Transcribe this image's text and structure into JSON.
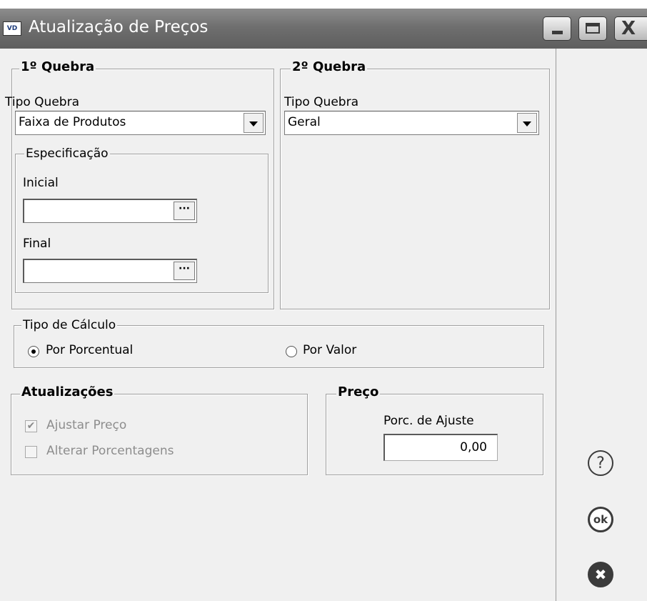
{
  "window": {
    "app_icon": "VD",
    "title": "Atualização de Preços"
  },
  "titlebar_buttons": {
    "close_glyph": "X"
  },
  "quebra1": {
    "legend": "1º Quebra",
    "tipo_label": "Tipo Quebra",
    "tipo_value": "Faixa de Produtos",
    "espec": {
      "legend": "Especificação",
      "inicial_label": "Inicial",
      "inicial_value": "",
      "final_label": "Final",
      "final_value": "",
      "lookup_glyph": "···"
    }
  },
  "quebra2": {
    "legend": "2º Quebra",
    "tipo_label": "Tipo Quebra",
    "tipo_value": "Geral"
  },
  "calculo": {
    "legend": "Tipo de Cálculo",
    "options": [
      "Por Porcentual",
      "Por Valor"
    ],
    "selected": "Por Porcentual"
  },
  "atualizacoes": {
    "legend": "Atualizações",
    "ajustar_preco": {
      "label": "Ajustar Preço",
      "checked": true,
      "check_glyph": "✔"
    },
    "alterar_porcentagens": {
      "label": "Alterar Porcentagens",
      "checked": false
    }
  },
  "preco": {
    "legend": "Preço",
    "porc_label": "Porc. de Ajuste",
    "porc_value": "0,00"
  },
  "side_buttons": {
    "help_glyph": "?",
    "ok_glyph": "ok",
    "cancel_glyph": "✖"
  },
  "icons": [
    "app-icon",
    "minimize-icon",
    "maximize-icon",
    "close-icon",
    "dropdown-arrow-icon",
    "ellipsis-icon",
    "help-icon",
    "ok-icon",
    "cancel-icon"
  ]
}
